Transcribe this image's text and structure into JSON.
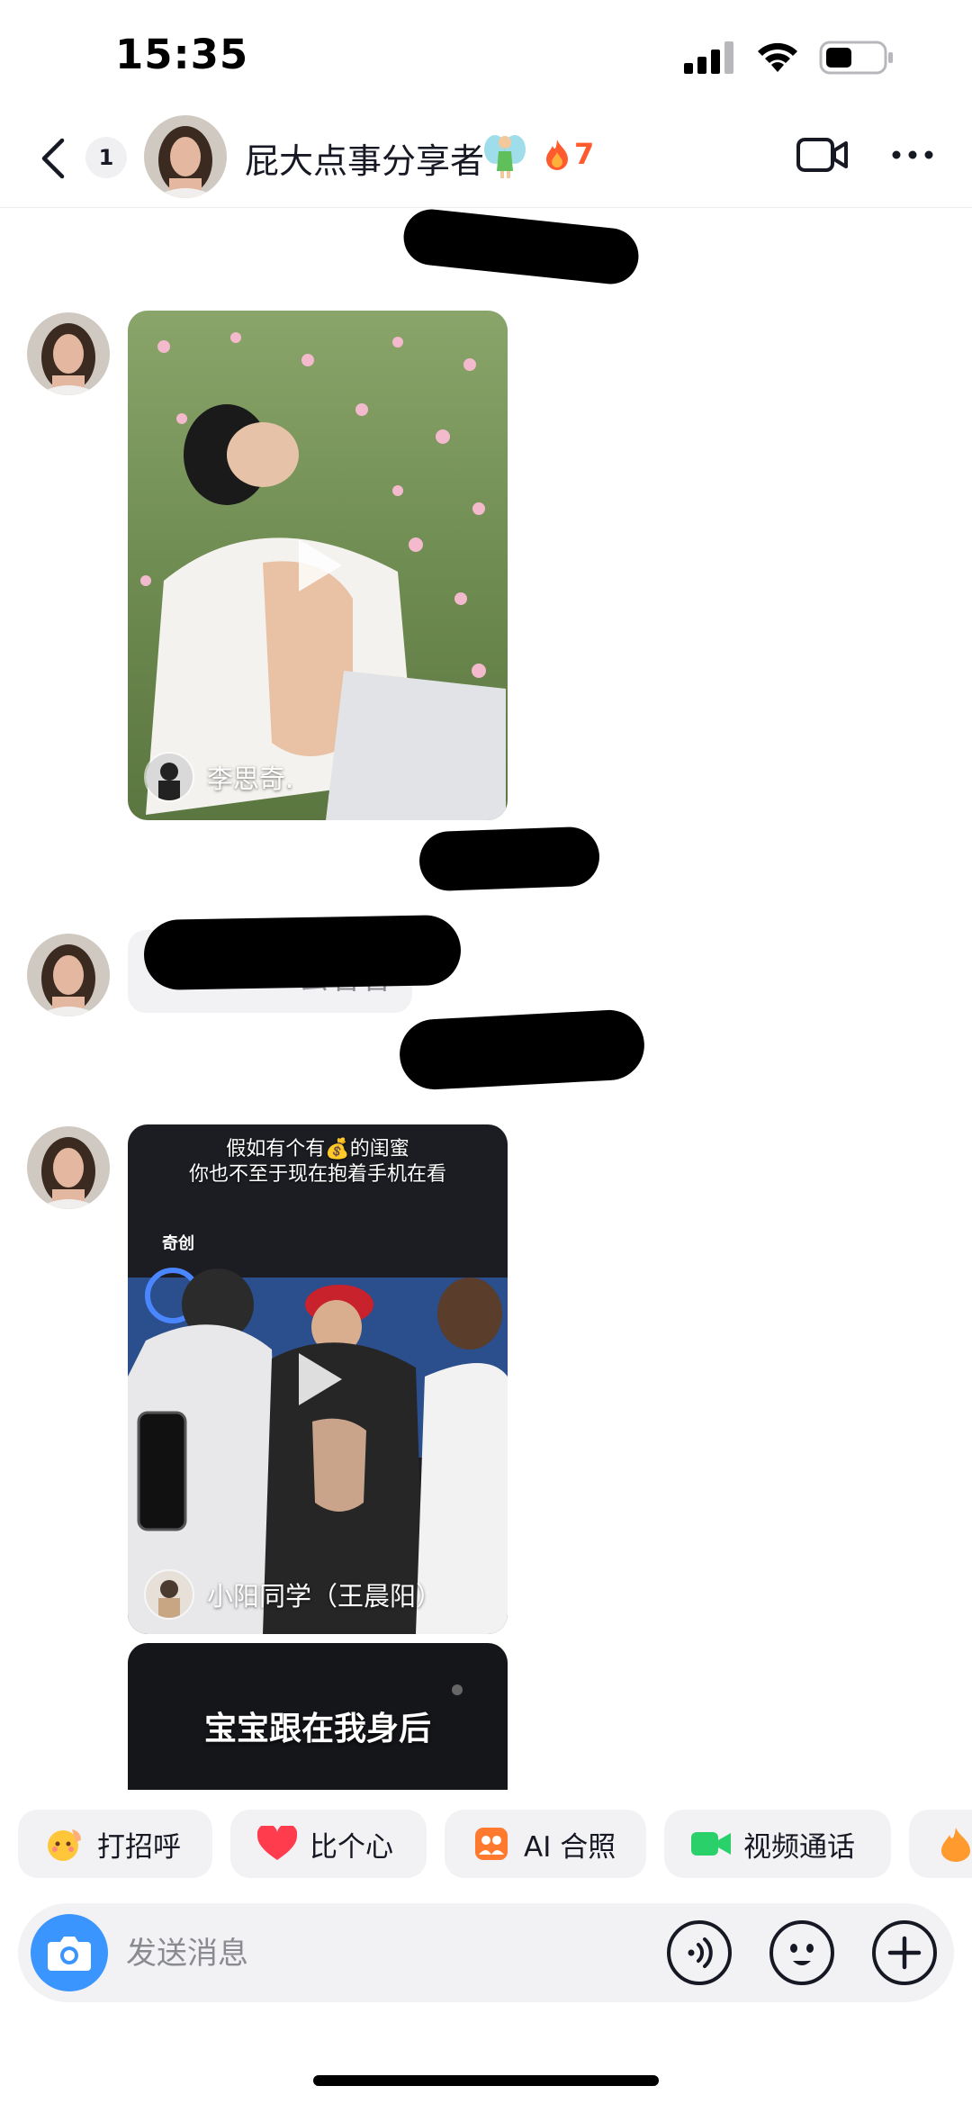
{
  "status_bar": {
    "time": "15:35",
    "icons": [
      "signal-icon",
      "wifi-icon",
      "battery-icon"
    ]
  },
  "header": {
    "unread_count": "1",
    "title": "屁大点事分享者",
    "title_emoji": "fairy-icon",
    "streak_count": "7",
    "streak_icon": "flame-icon",
    "actions": [
      "video-call-icon",
      "more-icon"
    ]
  },
  "messages": [
    {
      "type": "redacted"
    },
    {
      "type": "video",
      "author": "李思奇."
    },
    {
      "type": "redacted"
    },
    {
      "type": "text",
      "text": "去看看"
    },
    {
      "type": "redacted"
    },
    {
      "type": "video",
      "author": "小阳同学（王晨阳）",
      "caption": [
        "假如有个有💰的闺蜜",
        "你也不至于现在抱着手机在看"
      ],
      "watermark": "奇创"
    },
    {
      "type": "video",
      "caption": "宝宝跟在我身后"
    }
  ],
  "quick_actions": [
    {
      "label": "打招呼",
      "icon": "wave-emoji-icon"
    },
    {
      "label": "比个心",
      "icon": "heart-icon"
    },
    {
      "label": "AI 合照",
      "icon": "ai-photo-icon"
    },
    {
      "label": "视频通话",
      "icon": "video-call-icon"
    }
  ],
  "input": {
    "placeholder": "发送消息",
    "value": ""
  },
  "colors": {
    "accent_blue": "#3a95ff",
    "streak_orange": "#ff5b2e",
    "chip_bg": "#f2f2f4",
    "video_call_green": "#2ad16a"
  }
}
